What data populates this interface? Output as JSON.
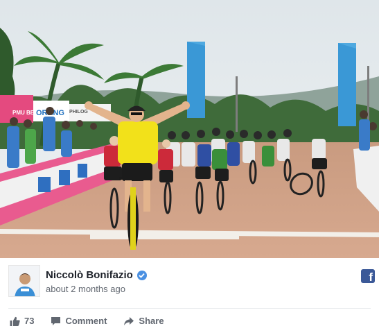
{
  "post": {
    "author": "Niccolò Bonifazio",
    "verified": true,
    "timestamp": "about 2 months ago",
    "platform_icon": "facebook-icon",
    "photo": {
      "description": "",
      "banner_texts": [
        "ORANG",
        "PMU BET",
        "PHILOG"
      ]
    }
  },
  "actions": {
    "like_count": "73",
    "comment_label": "Comment",
    "share_label": "Share"
  },
  "colors": {
    "accent": "#4a90e2",
    "facebook_blue": "#3b5998",
    "muted_text": "#616770",
    "jersey_yellow": "#f2e11a"
  }
}
